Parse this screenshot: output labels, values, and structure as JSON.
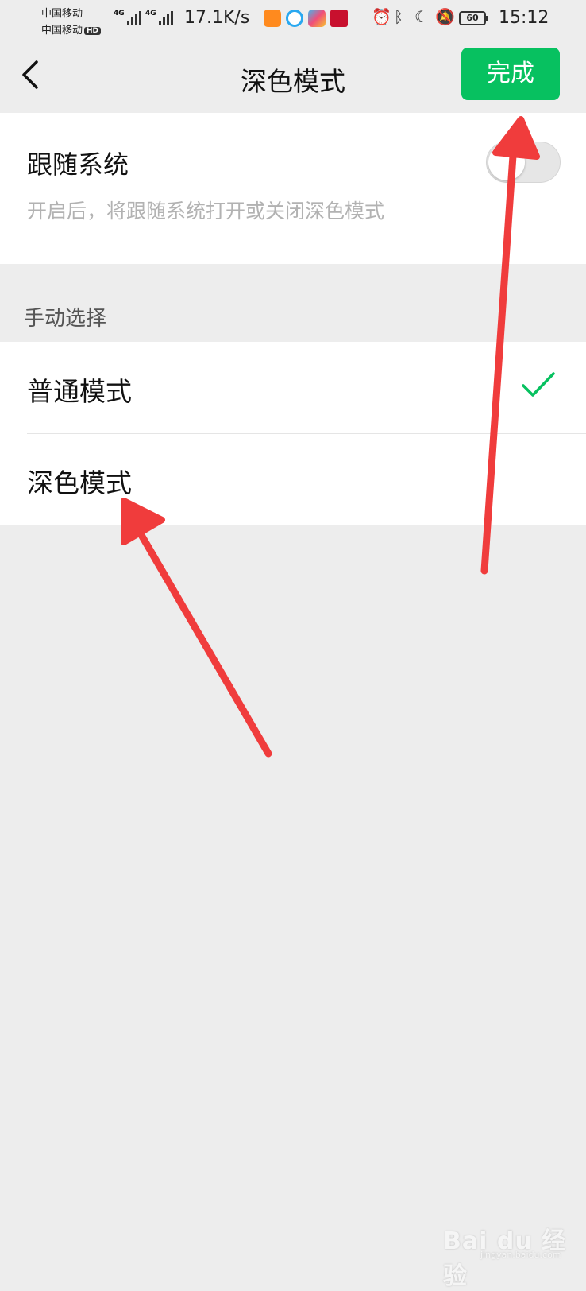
{
  "status_bar": {
    "carrier1": "中国移动",
    "carrier2": "中国移动",
    "hd": "HD",
    "network1": "4G",
    "network2": "4G",
    "net_speed": "17.1K/s",
    "battery": "60",
    "time": "15:12"
  },
  "nav": {
    "title": "深色模式",
    "done_label": "完成"
  },
  "follow_system": {
    "title": "跟随系统",
    "description": "开启后，将跟随系统打开或关闭深色模式",
    "enabled": false
  },
  "manual": {
    "section_label": "手动选择",
    "options": [
      {
        "label": "普通模式",
        "selected": true
      },
      {
        "label": "深色模式",
        "selected": false
      }
    ]
  },
  "watermark": {
    "brand": "Bai du 经验",
    "url": "jingyan.baidu.com"
  },
  "colors": {
    "accent": "#07c160",
    "annotation_arrow": "#f03c3c",
    "background": "#ededed"
  }
}
